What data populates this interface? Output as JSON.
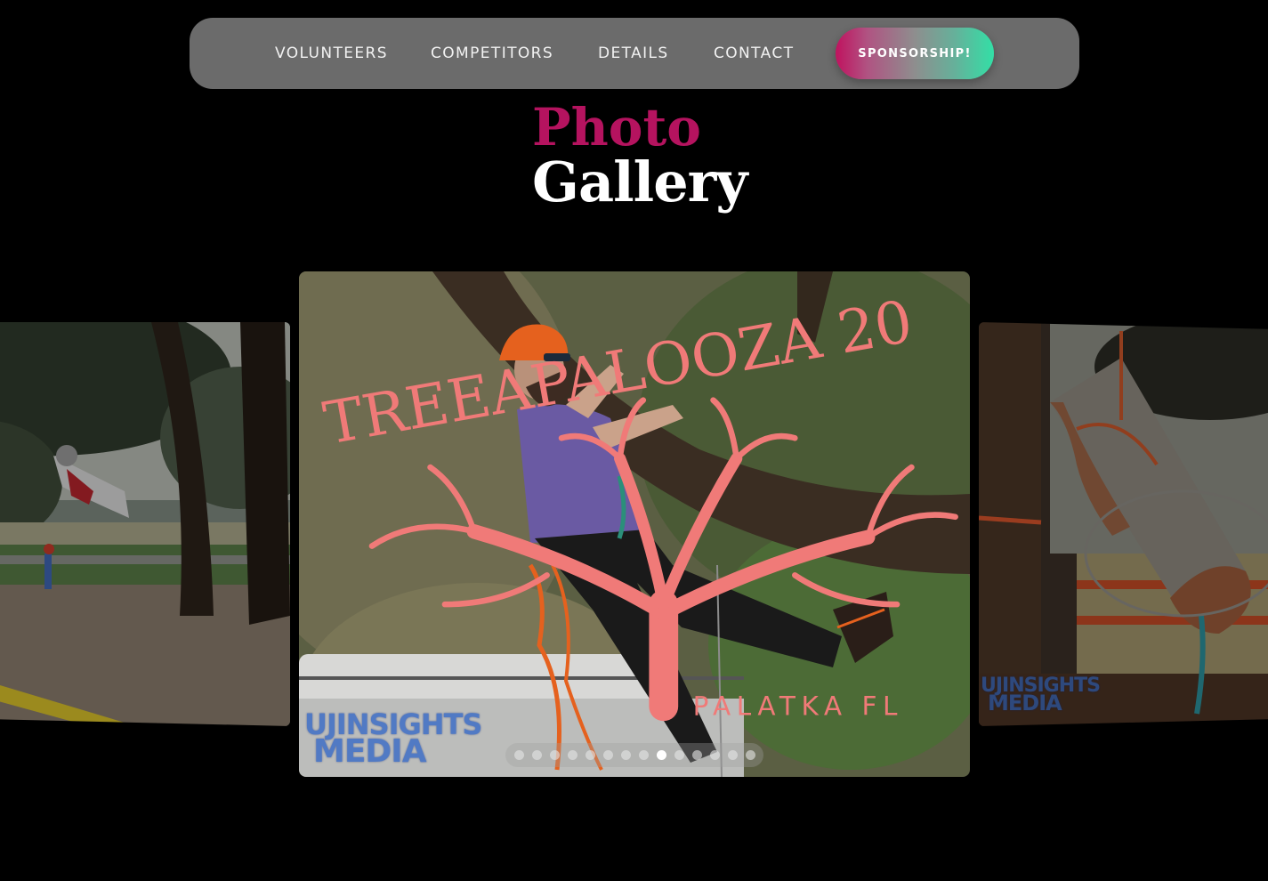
{
  "nav": {
    "links": [
      {
        "label": "VOLUNTEERS"
      },
      {
        "label": "COMPETITORS"
      },
      {
        "label": "DETAILS"
      },
      {
        "label": "CONTACT"
      }
    ],
    "cta_label": "SPONSORSHIP!"
  },
  "title": {
    "line1": "Photo",
    "line2": "Gallery",
    "accent_color": "#b5135f"
  },
  "carousel": {
    "slides": [
      {
        "position": "previous",
        "description": "Child climber swinging from a large oak tree near caution tape",
        "watermark": null
      },
      {
        "position": "current",
        "description": "Bearded arborist in orange helmet and purple shirt climbing a mossy oak",
        "watermark": {
          "line1": "UJINSIGHTS",
          "line2": "MEDIA"
        },
        "logo": {
          "text": "TREEAPALOOZA 20",
          "subtext": "PALATKA FL"
        }
      },
      {
        "position": "next",
        "description": "Cut log rigged with orange and blue ropes hanging from a tree",
        "watermark": {
          "line1": "UJINSIGHTS",
          "line2": "MEDIA"
        }
      }
    ],
    "pagination": {
      "total": 14,
      "active_index": 8
    }
  },
  "icons": {
    "dot": "pagination-dot"
  }
}
